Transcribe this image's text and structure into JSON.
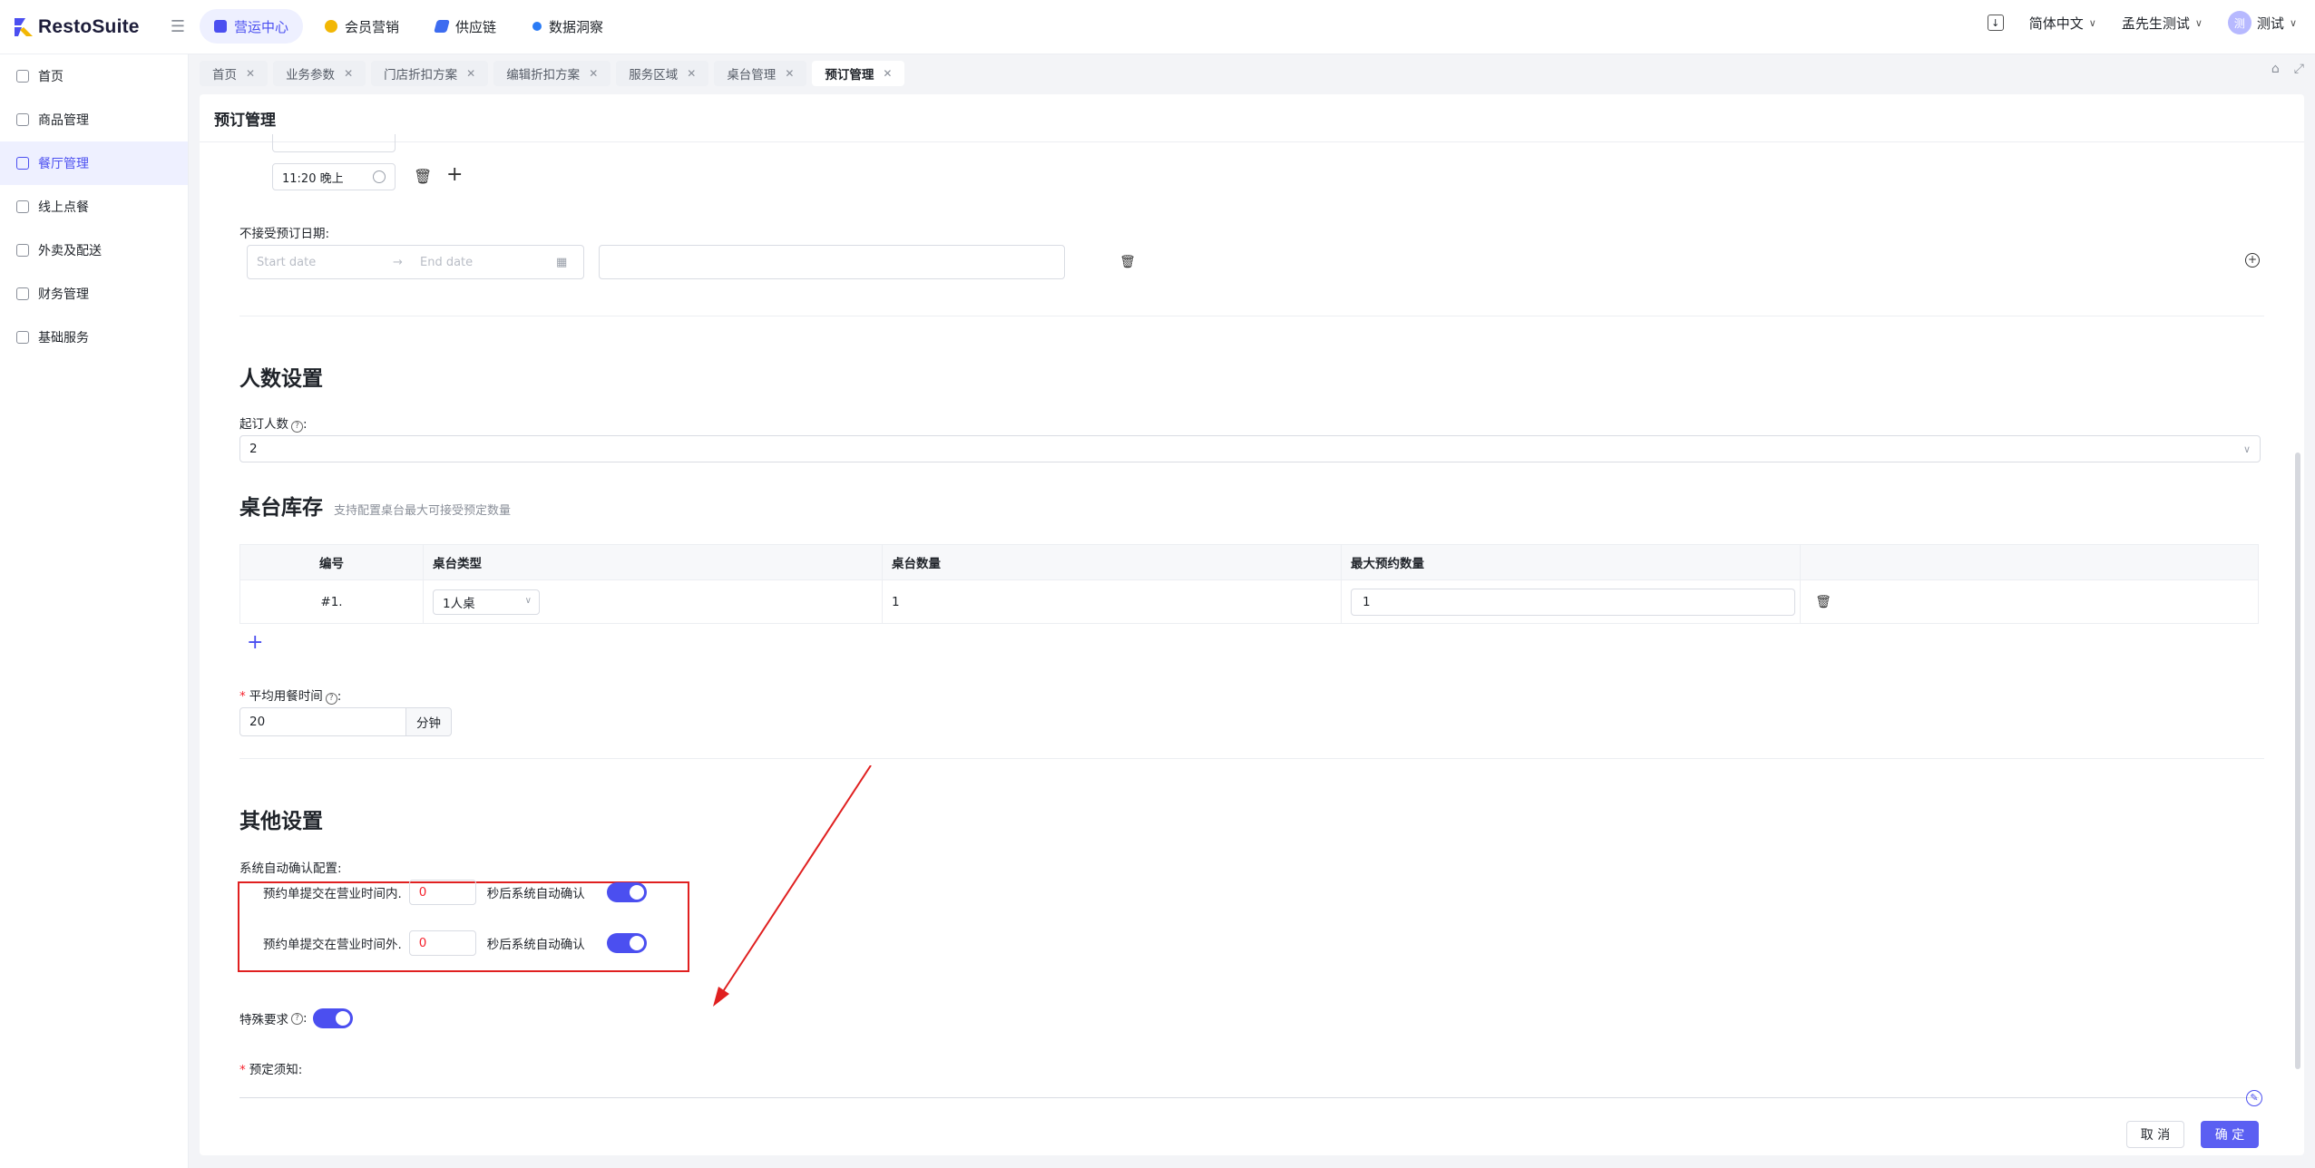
{
  "app": {
    "logo_text": "RestoSuite"
  },
  "topnav": [
    {
      "label": "营运中心",
      "active": true,
      "color": "#4b4ff0"
    },
    {
      "label": "会员营销",
      "active": false,
      "color": "#f2b705"
    },
    {
      "label": "供应链",
      "active": false,
      "color": "#3d6cf0"
    },
    {
      "label": "数据洞察",
      "active": false,
      "color": "#2a7bf5"
    }
  ],
  "topright": {
    "language": "简体中文",
    "store": "孟先生测试",
    "avatar_char": "测",
    "user": "测试"
  },
  "sidebar": [
    {
      "label": "首页",
      "active": false
    },
    {
      "label": "商品管理",
      "active": false
    },
    {
      "label": "餐厅管理",
      "active": true
    },
    {
      "label": "线上点餐",
      "active": false
    },
    {
      "label": "外卖及配送",
      "active": false
    },
    {
      "label": "财务管理",
      "active": false
    },
    {
      "label": "基础服务",
      "active": false
    }
  ],
  "tabs": [
    {
      "label": "首页",
      "active": false
    },
    {
      "label": "业务参数",
      "active": false
    },
    {
      "label": "门店折扣方案",
      "active": false
    },
    {
      "label": "编辑折扣方案",
      "active": false
    },
    {
      "label": "服务区域",
      "active": false
    },
    {
      "label": "桌台管理",
      "active": false
    },
    {
      "label": "预订管理",
      "active": true
    }
  ],
  "page": {
    "title": "预订管理",
    "time_value": "11:20 晚上",
    "no_booking_label": "不接受预订日期:",
    "start_placeholder": "Start date",
    "end_placeholder": "End date",
    "headcount_title": "人数设置",
    "min_people_label": "起订人数",
    "min_people_value": "2",
    "inventory_title": "桌台库存",
    "inventory_hint": "支持配置桌台最大可接受预定数量",
    "table": {
      "headers": [
        "编号",
        "桌台类型",
        "桌台数量",
        "最大预约数量"
      ],
      "rows": [
        {
          "no": "#1.",
          "type": "1人桌",
          "count": "1",
          "max": "1"
        }
      ]
    },
    "avg_time_label": "平均用餐时间",
    "avg_time_value": "20",
    "avg_time_unit": "分钟",
    "other_title": "其他设置",
    "auto_confirm_label": "系统自动确认配置:",
    "auto_confirm_inside_label": "预约单提交在营业时间内.",
    "auto_confirm_inside_value": "0",
    "auto_confirm_outside_label": "预约单提交在营业时间外.",
    "auto_confirm_outside_value": "0",
    "auto_confirm_suffix": "秒后系统自动确认",
    "special_label": "特殊要求",
    "notice_label": "预定须知:",
    "cancel_btn": "取 消",
    "ok_btn": "确 定"
  },
  "colors": {
    "accent": "#4b4ff0",
    "highlight_box": "#e02020"
  }
}
